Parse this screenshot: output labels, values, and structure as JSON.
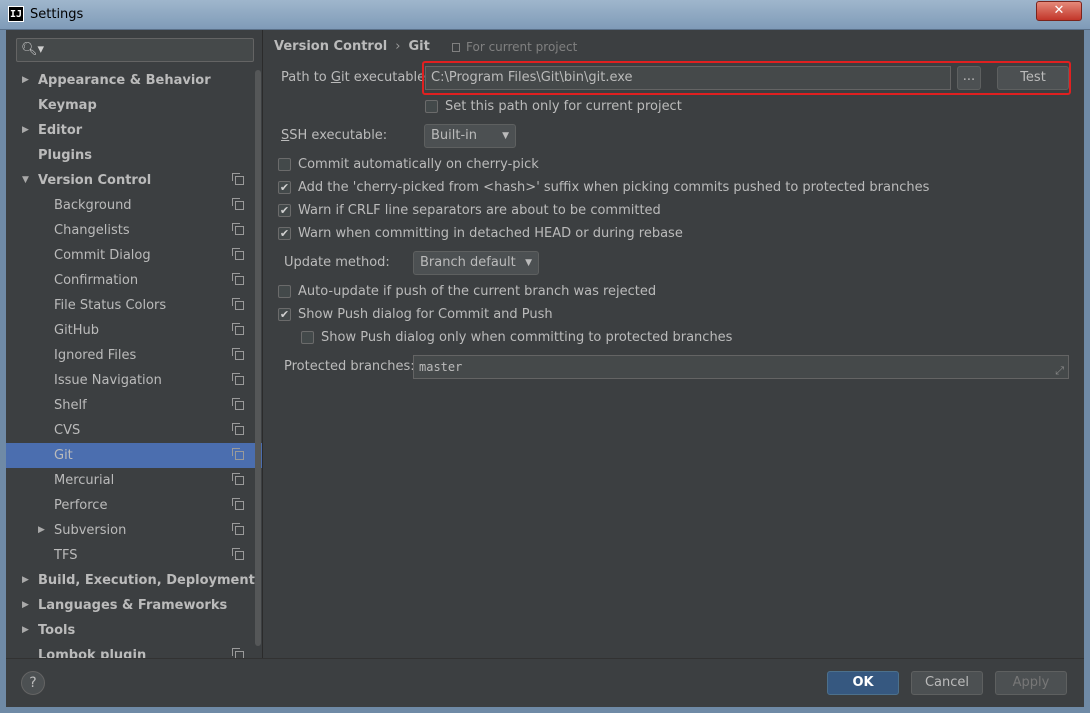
{
  "window": {
    "title": "Settings",
    "app_icon_text": "IJ",
    "close_glyph": "✕"
  },
  "sidebar": {
    "search_placeholder": "",
    "search_icon": "search-icon",
    "items": [
      {
        "label": "Appearance & Behavior",
        "level": 0,
        "arrow": "right",
        "bold": true,
        "copy": false
      },
      {
        "label": "Keymap",
        "level": 0,
        "arrow": "",
        "bold": true,
        "copy": false
      },
      {
        "label": "Editor",
        "level": 0,
        "arrow": "right",
        "bold": true,
        "copy": false
      },
      {
        "label": "Plugins",
        "level": 0,
        "arrow": "",
        "bold": true,
        "copy": false
      },
      {
        "label": "Version Control",
        "level": 0,
        "arrow": "down",
        "bold": true,
        "copy": true
      },
      {
        "label": "Background",
        "level": 1,
        "arrow": "",
        "bold": false,
        "copy": true
      },
      {
        "label": "Changelists",
        "level": 1,
        "arrow": "",
        "bold": false,
        "copy": true
      },
      {
        "label": "Commit Dialog",
        "level": 1,
        "arrow": "",
        "bold": false,
        "copy": true
      },
      {
        "label": "Confirmation",
        "level": 1,
        "arrow": "",
        "bold": false,
        "copy": true
      },
      {
        "label": "File Status Colors",
        "level": 1,
        "arrow": "",
        "bold": false,
        "copy": true
      },
      {
        "label": "GitHub",
        "level": 1,
        "arrow": "",
        "bold": false,
        "copy": true
      },
      {
        "label": "Ignored Files",
        "level": 1,
        "arrow": "",
        "bold": false,
        "copy": true
      },
      {
        "label": "Issue Navigation",
        "level": 1,
        "arrow": "",
        "bold": false,
        "copy": true
      },
      {
        "label": "Shelf",
        "level": 1,
        "arrow": "",
        "bold": false,
        "copy": true
      },
      {
        "label": "CVS",
        "level": 1,
        "arrow": "",
        "bold": false,
        "copy": true
      },
      {
        "label": "Git",
        "level": 1,
        "arrow": "",
        "bold": false,
        "copy": true,
        "selected": true
      },
      {
        "label": "Mercurial",
        "level": 1,
        "arrow": "",
        "bold": false,
        "copy": true
      },
      {
        "label": "Perforce",
        "level": 1,
        "arrow": "",
        "bold": false,
        "copy": true
      },
      {
        "label": "Subversion",
        "level": 1,
        "arrow": "right",
        "bold": false,
        "copy": true
      },
      {
        "label": "TFS",
        "level": 1,
        "arrow": "",
        "bold": false,
        "copy": true
      },
      {
        "label": "Build, Execution, Deployment",
        "level": 0,
        "arrow": "right",
        "bold": true,
        "copy": false
      },
      {
        "label": "Languages & Frameworks",
        "level": 0,
        "arrow": "right",
        "bold": true,
        "copy": false
      },
      {
        "label": "Tools",
        "level": 0,
        "arrow": "right",
        "bold": true,
        "copy": false
      },
      {
        "label": "Lombok plugin",
        "level": 0,
        "arrow": "",
        "bold": true,
        "copy": true
      }
    ]
  },
  "breadcrumb": {
    "parent": "Version Control",
    "separator": "›",
    "current": "Git",
    "note": "For current project"
  },
  "git": {
    "path_label_pre": "Path to ",
    "path_label_u": "G",
    "path_label_post": "it executable:",
    "path_value": "C:\\Program Files\\Git\\bin\\git.exe",
    "browse_label": "...",
    "test_label": "Test",
    "set_path_only_label": "Set this path only for current project",
    "set_path_only_checked": false,
    "ssh_label_u": "S",
    "ssh_label_post": "SH executable:",
    "ssh_value": "Built-in",
    "options": [
      {
        "label": "Commit automatically on cherry-pick",
        "checked": false
      },
      {
        "label": "Add the 'cherry-picked from <hash>' suffix when picking commits pushed to protected branches",
        "checked": true
      },
      {
        "label": "Warn if CRLF line separators are about to be committed",
        "checked": true
      },
      {
        "label": "Warn when committing in detached HEAD or during rebase",
        "checked": true
      }
    ],
    "update_method_label": "Update method:",
    "update_method_value": "Branch default",
    "push_options": [
      {
        "label": "Auto-update if push of the current branch was rejected",
        "checked": false
      },
      {
        "label": "Show Push dialog for Commit and Push",
        "checked": true
      }
    ],
    "push_sub_option": {
      "label": "Show Push dialog only when committing to protected branches",
      "checked": false
    },
    "protected_label": "Protected branches:",
    "protected_value": "master"
  },
  "footer": {
    "help_label": "?",
    "ok_label": "OK",
    "cancel_label": "Cancel",
    "apply_label": "Apply"
  },
  "colors": {
    "selection": "#4b6eaf",
    "highlight_outline": "#e02020",
    "background": "#3c3f41"
  }
}
